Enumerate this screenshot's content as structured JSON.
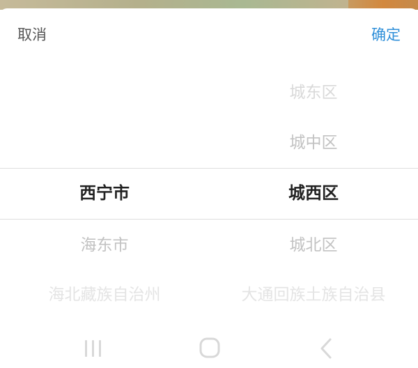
{
  "toolbar": {
    "cancel_label": "取消",
    "confirm_label": "确定",
    "confirm_color": "#2f8fd9"
  },
  "picker": {
    "city_column": {
      "items": [
        "西宁市",
        "海东市",
        "海北藏族自治州"
      ],
      "selected": "西宁市"
    },
    "district_column": {
      "items": [
        "城东区",
        "城中区",
        "城西区",
        "城北区",
        "大通回族土族自治县"
      ],
      "selected": "城西区"
    }
  },
  "navbar": {
    "icons": [
      "recents-icon",
      "home-icon",
      "back-icon"
    ]
  }
}
